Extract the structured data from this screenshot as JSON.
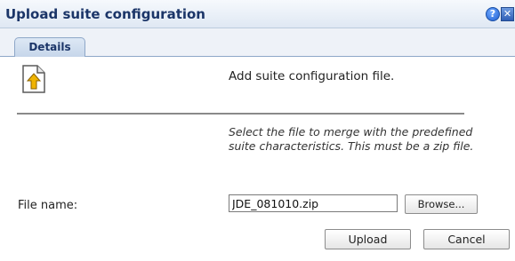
{
  "dialog": {
    "title": "Upload suite configuration",
    "help_icon_glyph": "?",
    "close_icon_glyph": "✕"
  },
  "tabs": [
    {
      "label": "Details",
      "selected": true
    }
  ],
  "content": {
    "heading": "Add suite configuration file.",
    "hint": "Select the file to merge with the predefined suite characteristics. This must be a zip file.",
    "file_label": "File name:",
    "file_value": "JDE_081010.zip",
    "browse_label": "Browse..."
  },
  "actions": {
    "upload_label": "Upload",
    "cancel_label": "Cancel"
  },
  "icons": {
    "document": "upload-document-icon",
    "help": "help-icon",
    "close": "close-icon"
  },
  "colors": {
    "title_text": "#1b3568",
    "title_bg": "#dfe8f3",
    "accent_arrow": "#f0b400"
  }
}
